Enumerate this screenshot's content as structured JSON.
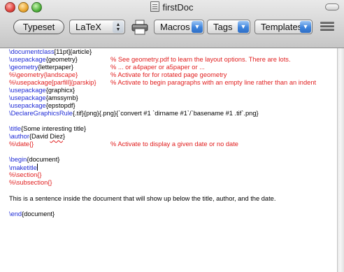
{
  "window": {
    "title": "firstDoc",
    "icons": {
      "close": "close-icon",
      "minimize": "minimize-icon",
      "zoom": "zoom-icon",
      "document": "document-icon",
      "toolbar_toggle": "toolbar-toggle-icon"
    }
  },
  "toolbar": {
    "typeset_label": "Typeset",
    "engine": {
      "selected": "LaTeX",
      "icon": "up-down-arrows-icon"
    },
    "print_icon": "printer-icon",
    "macros_label": "Macros",
    "tags_label": "Tags",
    "templates_label": "Templates",
    "options_icon": "list-lines-icon",
    "accent_color": "#3d83dc"
  },
  "editor": {
    "colors": {
      "command": "#1f2bd6",
      "comment": "#e12020",
      "text": "#000000"
    },
    "lines": [
      {
        "cmd": "\\documentclass",
        "arg": "[11pt]{article}",
        "comment": ""
      },
      {
        "cmd": "\\usepackage",
        "arg": "{geometry}",
        "comment": "% See geometry.pdf to learn the layout options. There are lots."
      },
      {
        "cmd": "\\geometry",
        "arg": "{letterpaper}",
        "comment": "% ... or a4paper or a5paper or ..."
      },
      {
        "full_comment": "%\\geometry{landscape}",
        "comment": "% Activate for for rotated page geometry"
      },
      {
        "full_comment": "%\\usepackage[parfill]{parskip}",
        "comment": "% Activate to begin paragraphs with an empty line rather than an indent"
      },
      {
        "cmd": "\\usepackage",
        "arg": "{graphicx}"
      },
      {
        "cmd": "\\usepackage",
        "arg": "{amssymb}"
      },
      {
        "cmd": "\\usepackage",
        "arg": "{epstopdf}"
      },
      {
        "cmd": "\\DeclareGraphicsRule",
        "arg": "{.tif}{png}{.png}{`convert #1 `dirname #1`/`basename #1 .tif`.png}"
      },
      {
        "cmd": "\\title",
        "arg": "{Some interesting title}"
      },
      {
        "cmd": "\\author",
        "arg_pre": "{David ",
        "arg_squig": "Diez",
        "arg_post": "}"
      },
      {
        "full_comment": "%\\date{}",
        "comment": "% Activate to display a given date or no date"
      },
      {
        "cmd": "\\begin",
        "arg": "{document}"
      },
      {
        "cmd": "\\maketitle"
      },
      {
        "full_comment": "%\\section{}"
      },
      {
        "full_comment": "%\\subsection{}"
      },
      {
        "text": "This is a sentence inside the document that will show up below the title, author, and the date."
      },
      {
        "cmd": "\\end",
        "arg": "{document}"
      }
    ]
  }
}
